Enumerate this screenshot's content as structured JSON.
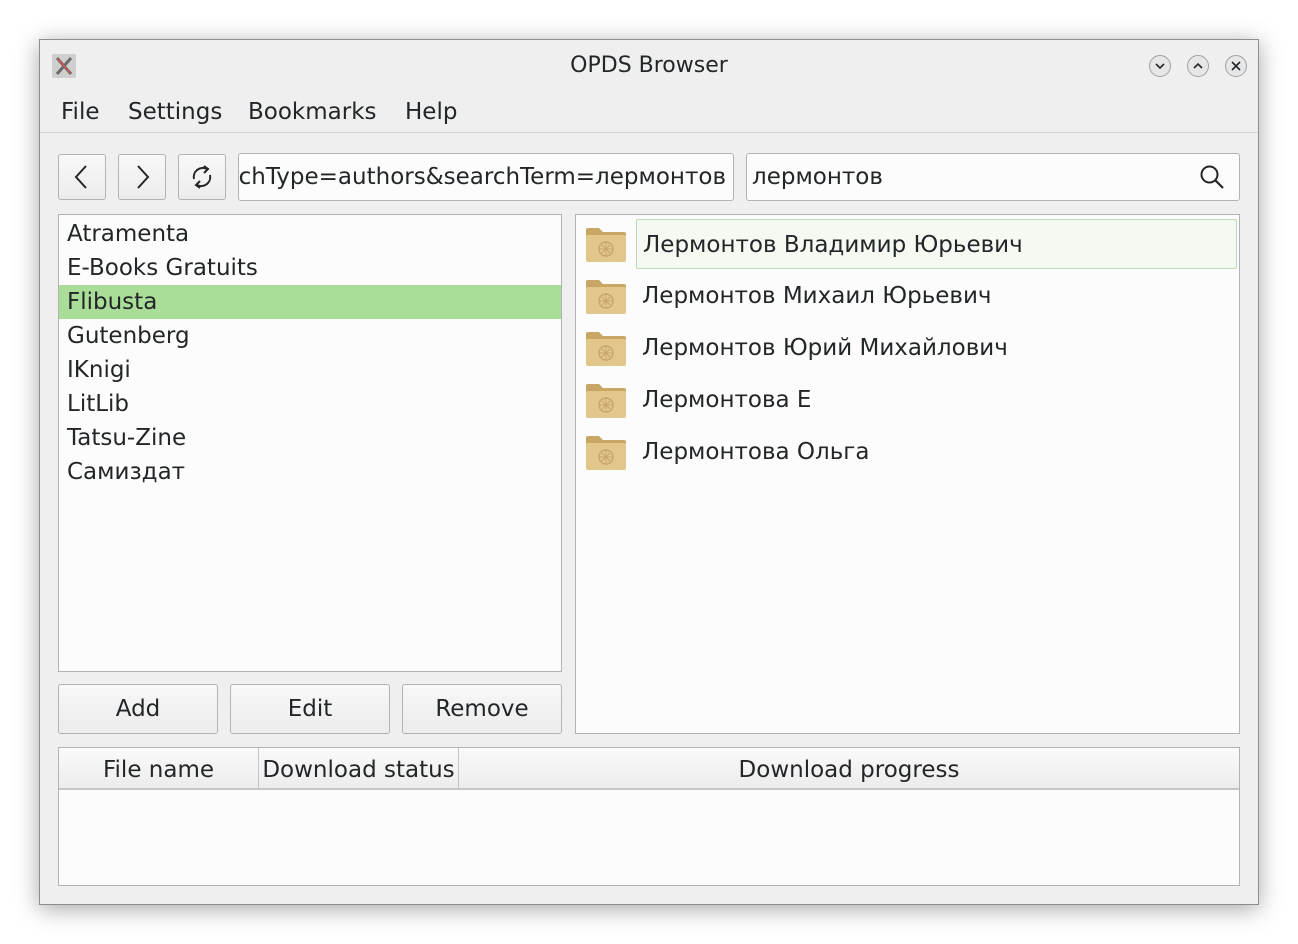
{
  "window": {
    "title": "OPDS Browser",
    "app_icon": "x-app-icon"
  },
  "title_buttons": [
    {
      "name": "minimize-icon"
    },
    {
      "name": "maximize-icon"
    },
    {
      "name": "close-icon"
    }
  ],
  "menu": [
    "File",
    "Settings",
    "Bookmarks",
    "Help"
  ],
  "toolbar": {
    "back_icon": "chevron-left-icon",
    "forward_icon": "chevron-right-icon",
    "reload_icon": "reload-icon",
    "url_value": "rchType=authors&searchTerm=лермонтов",
    "search_value": "лермонтов",
    "search_icon": "search-icon"
  },
  "catalogs": [
    "Atramenta",
    "E-Books Gratuits",
    "Flibusta",
    "Gutenberg",
    "IKnigi",
    "LitLib",
    "Tatsu-Zine",
    "Самиздат"
  ],
  "selected_catalog": "Flibusta",
  "catalog_buttons": {
    "add": "Add",
    "edit": "Edit",
    "remove": "Remove"
  },
  "results": [
    {
      "label": "Лермонтов Владимир Юрьевич",
      "icon": "folder-icon"
    },
    {
      "label": "Лермонтов Михаил Юрьевич",
      "icon": "folder-icon"
    },
    {
      "label": "Лермонтов Юрий Михайлович",
      "icon": "folder-icon"
    },
    {
      "label": "Лермонтова Е",
      "icon": "folder-icon"
    },
    {
      "label": "Лермонтова Ольга",
      "icon": "folder-icon"
    }
  ],
  "downloads": {
    "columns": [
      "File name",
      "Download status",
      "Download progress"
    ],
    "rows": []
  },
  "colors": {
    "selection": "#aade98",
    "window_bg": "#efefef",
    "list_bg": "#fcfcfc"
  }
}
